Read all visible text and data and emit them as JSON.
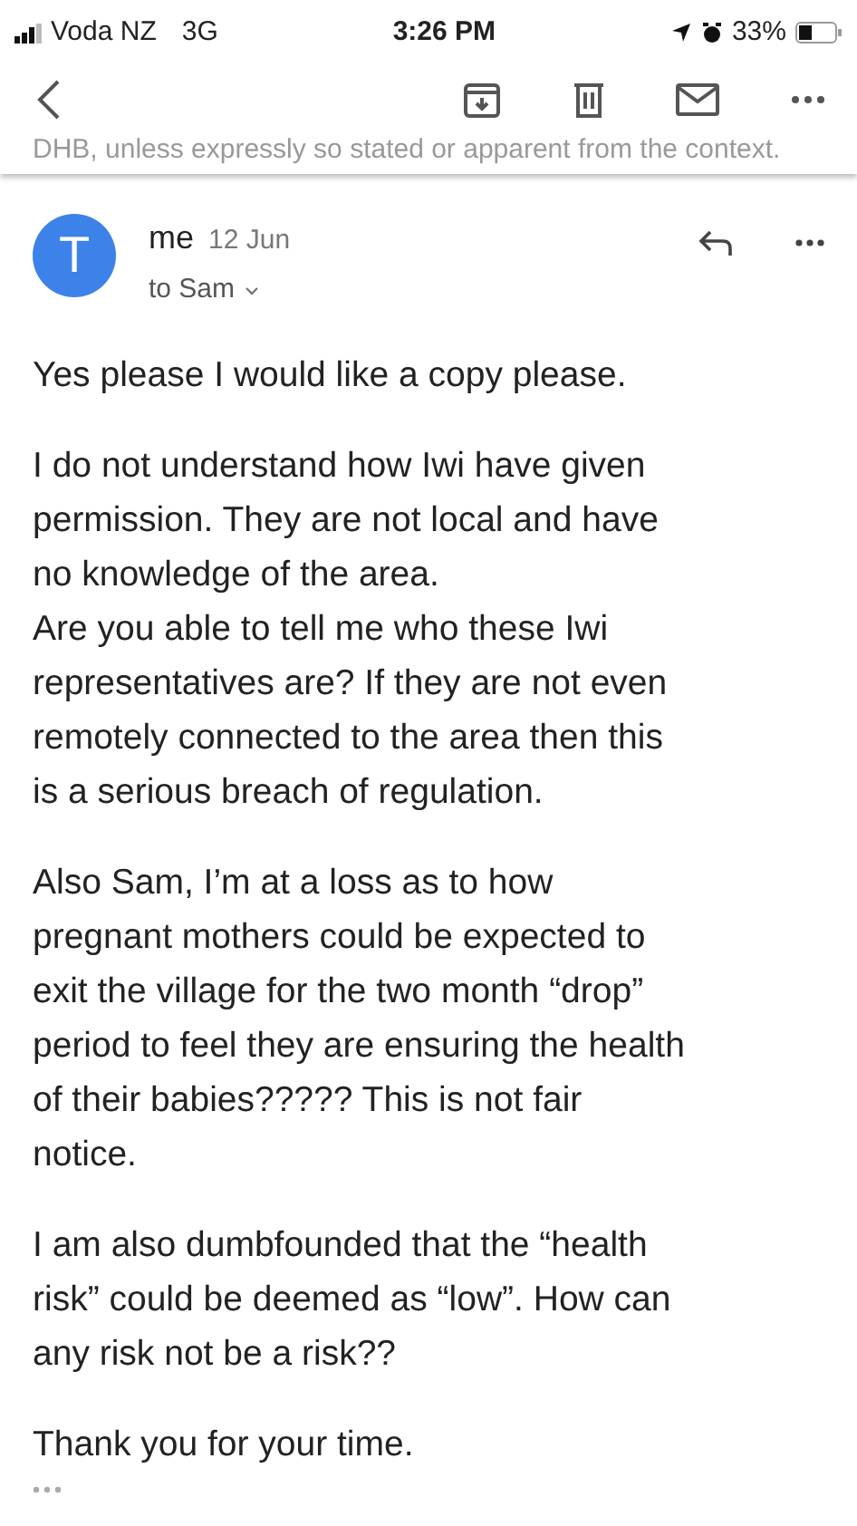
{
  "status_bar": {
    "carrier": "Voda NZ",
    "network": "3G",
    "time": "3:26 PM",
    "battery": "33%"
  },
  "background_text": "DHB, unless expressly so stated or apparent from the context.",
  "message": {
    "avatar": "T",
    "sender": "me",
    "date": "12 Jun",
    "recipient": "to Sam",
    "paragraphs": [
      [
        "Yes please I would like a copy please."
      ],
      [
        "I do not understand how Iwi have given",
        "permission. They are not local and have",
        "no knowledge of the area.",
        "Are you able to tell me who these Iwi",
        "representatives are? If they are not even",
        "remotely connected to the area then this",
        "is a serious breach of regulation."
      ],
      [
        "Also Sam, I’m at a loss as to how",
        "pregnant mothers could be expected to",
        "exit the village for the two month “drop”",
        "period to feel they are ensuring the health",
        "of their babies????? This is not fair",
        "notice."
      ],
      [
        "I am also dumbfounded that the “health",
        "risk” could be deemed as “low”. How can",
        "any risk not be a risk??"
      ],
      [
        "Thank you for your time."
      ]
    ]
  }
}
